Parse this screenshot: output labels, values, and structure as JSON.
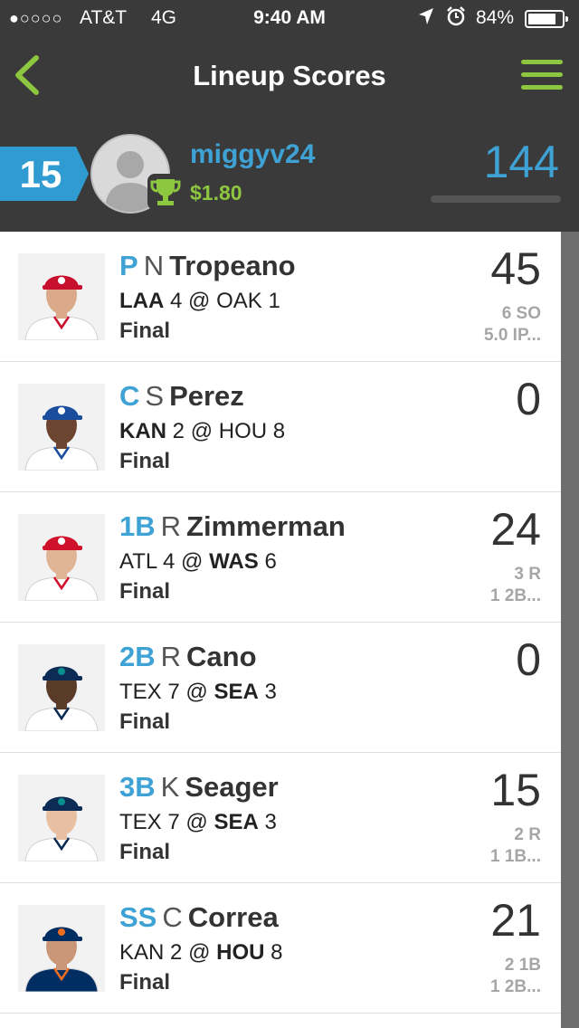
{
  "status_bar": {
    "signal_dots": "●○○○○",
    "carrier": "AT&T",
    "network": "4G",
    "time": "9:40 AM",
    "battery": "84%",
    "battery_fraction": 0.84
  },
  "header": {
    "title": "Lineup Scores"
  },
  "profile": {
    "rank": "15",
    "username": "miggyv24",
    "winnings": "$1.80",
    "total_score": "144"
  },
  "colors": {
    "accent_blue": "#3ea2d4",
    "accent_green": "#8dc63f",
    "header_bg": "#3a3a3a"
  },
  "players": [
    {
      "position": "P",
      "initial": "N",
      "last_name": "Tropeano",
      "away_team": "LAA",
      "away_score": "4",
      "at": "@",
      "home_team": "OAK",
      "home_score": "1",
      "bold": "away",
      "status": "Final",
      "points": "45",
      "stat1": "6 SO",
      "stat2": "5.0 IP...",
      "jersey": "angels"
    },
    {
      "position": "C",
      "initial": "S",
      "last_name": "Perez",
      "away_team": "KAN",
      "away_score": "2",
      "at": "@",
      "home_team": "HOU",
      "home_score": "8",
      "bold": "away",
      "status": "Final",
      "points": "0",
      "stat1": "",
      "stat2": "",
      "jersey": "royals"
    },
    {
      "position": "1B",
      "initial": "R",
      "last_name": "Zimmerman",
      "away_team": "ATL",
      "away_score": "4",
      "at": "@",
      "home_team": "WAS",
      "home_score": "6",
      "bold": "home",
      "status": "Final",
      "points": "24",
      "stat1": "3 R",
      "stat2": "1 2B...",
      "jersey": "nationals"
    },
    {
      "position": "2B",
      "initial": "R",
      "last_name": "Cano",
      "away_team": "TEX",
      "away_score": "7",
      "at": "@",
      "home_team": "SEA",
      "home_score": "3",
      "bold": "home",
      "status": "Final",
      "points": "0",
      "stat1": "",
      "stat2": "",
      "jersey": "mariners"
    },
    {
      "position": "3B",
      "initial": "K",
      "last_name": "Seager",
      "away_team": "TEX",
      "away_score": "7",
      "at": "@",
      "home_team": "SEA",
      "home_score": "3",
      "bold": "home",
      "status": "Final",
      "points": "15",
      "stat1": "2 R",
      "stat2": "1 1B...",
      "jersey": "mariners"
    },
    {
      "position": "SS",
      "initial": "C",
      "last_name": "Correa",
      "away_team": "KAN",
      "away_score": "2",
      "at": "@",
      "home_team": "HOU",
      "home_score": "8",
      "bold": "home",
      "status": "Final",
      "points": "21",
      "stat1": "2 1B",
      "stat2": "1 2B...",
      "jersey": "astros"
    }
  ]
}
